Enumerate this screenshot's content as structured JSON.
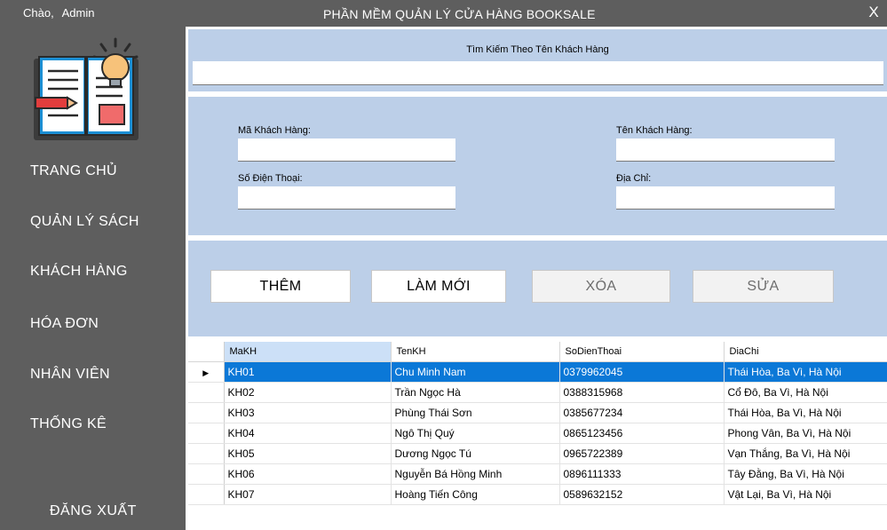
{
  "titlebar": {
    "greeting": "Chào,",
    "username": "Admin",
    "app_title": "PHẦN MỀM QUẢN LÝ CỬA HÀNG BOOKSALE",
    "close_label": "X"
  },
  "sidebar": {
    "logo_icon": "book-lightbulb-icon",
    "items": [
      {
        "label": "TRANG CHỦ"
      },
      {
        "label": "QUẢN LÝ SÁCH"
      },
      {
        "label": "KHÁCH HÀNG"
      },
      {
        "label": "HÓA ĐƠN"
      },
      {
        "label": "NHÂN VIÊN"
      },
      {
        "label": "THỐNG KÊ"
      }
    ],
    "logout_label": "ĐĂNG XUẤT"
  },
  "search": {
    "label": "Tìm Kiếm Theo Tên Khách Hàng",
    "value": ""
  },
  "form": {
    "ma_label": "Mã Khách Hàng:",
    "ma_value": "",
    "ten_label": "Tên Khách Hàng:",
    "ten_value": "",
    "sdt_label": "Số Điện Thoại:",
    "sdt_value": "",
    "diachi_label": "Địa Chỉ:",
    "diachi_value": ""
  },
  "buttons": {
    "add": "THÊM",
    "refresh": "LÀM MỚI",
    "delete": "XÓA",
    "edit": "SỬA"
  },
  "grid": {
    "columns": [
      "MaKH",
      "TenKH",
      "SoDienThoai",
      "DiaChi"
    ],
    "current_row_marker": "▶",
    "rows": [
      [
        "KH01",
        "Chu Minh Nam",
        "0379962045",
        "Thái Hòa, Ba Vì, Hà Nội"
      ],
      [
        "KH02",
        "Trần Ngọc Hà",
        "0388315968",
        "Cổ Đô, Ba Vì, Hà Nội"
      ],
      [
        "KH03",
        "Phùng Thái Sơn",
        "0385677234",
        "Thái Hòa, Ba Vì, Hà Nội"
      ],
      [
        "KH04",
        "Ngô Thị Quý",
        "0865123456",
        "Phong Vân, Ba Vì, Hà Nội"
      ],
      [
        "KH05",
        "Dương Ngọc Tú",
        "0965722389",
        "Vạn Thắng, Ba Vì, Hà Nội"
      ],
      [
        "KH06",
        "Nguyễn Bá Hồng Minh",
        "0896111333",
        "Tây Đằng, Ba Vì, Hà Nội"
      ],
      [
        "KH07",
        "Hoàng Tiến Công",
        "0589632152",
        "Vật Lại, Ba Vì, Hà Nội"
      ]
    ]
  },
  "colors": {
    "sidebar_bg": "#5e5e5e",
    "panel_bg": "#bccfe8",
    "selection": "#0b78d7"
  }
}
